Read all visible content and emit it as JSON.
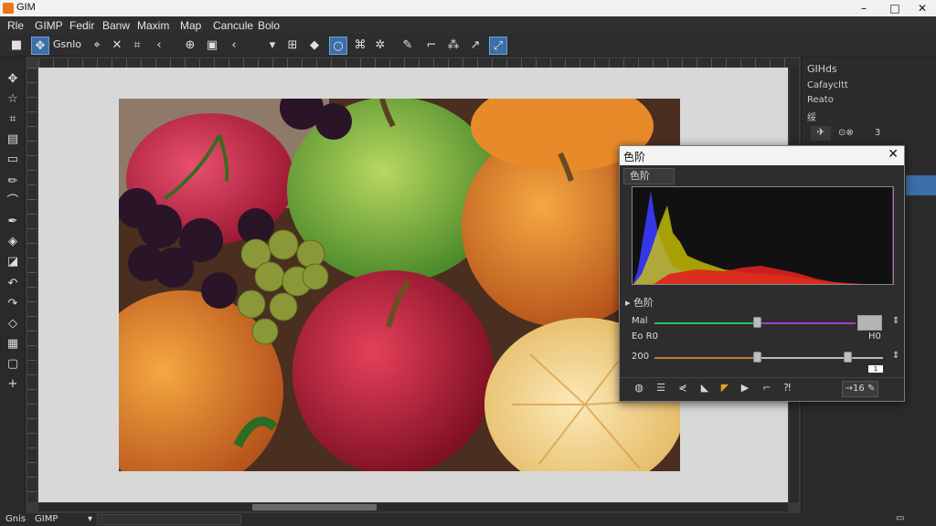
{
  "window": {
    "title": "GIM",
    "minimize": "–",
    "maximize": "□",
    "close": "✕"
  },
  "menu": [
    "Rle",
    "GIMP",
    "Fedir",
    "Banw",
    "Maxim",
    "Map",
    "Cancule",
    "Bolo"
  ],
  "toolbar": {
    "label": "Gsnlo"
  },
  "status": {
    "left": "Gnis",
    "app": "GIMP",
    "arrow": "▾"
  },
  "dock": {
    "title": "GIHds",
    "items": [
      "Cafaycltt",
      "Reato",
      "绥"
    ],
    "num": "3"
  },
  "dialog": {
    "title": "色阶",
    "close": "✕",
    "tab": "色阶",
    "section": "色阶",
    "row1_label": "Mal",
    "row2_left": "Eo R0",
    "row2_right": "H0",
    "row3_label": "200",
    "value_box": "1",
    "button": "→16"
  },
  "colors": {
    "accent": "#3c6fa8",
    "hist_blue": "#3a3cff",
    "hist_yellow": "#d8d000",
    "hist_red": "#e02020"
  }
}
